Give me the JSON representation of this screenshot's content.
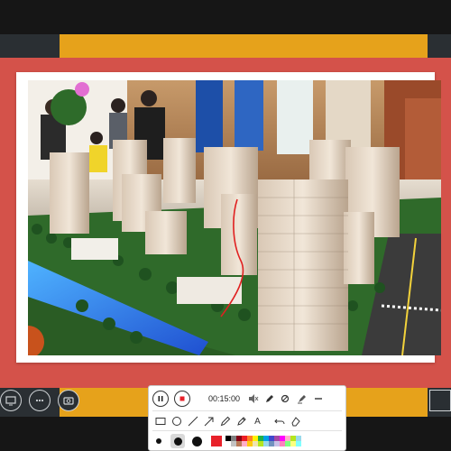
{
  "slide": {
    "colors": {
      "yellow": "#e6a21b",
      "red": "#d4524a",
      "dark": "#2a2f33"
    },
    "photo_subject": "residential-development-scale-model"
  },
  "meeting_controls": [
    {
      "name": "share-screen-icon"
    },
    {
      "name": "more-options-icon"
    },
    {
      "name": "camera-switch-icon"
    }
  ],
  "toolbar": {
    "timer": "00:15:00",
    "row1_icons": [
      "pause-icon",
      "stop-record-icon",
      "mute-icon",
      "pen-icon",
      "eraser-clear-icon",
      "highlighter-icon",
      "minimize-icon"
    ],
    "row2_tools": [
      "rectangle-tool-icon",
      "ellipse-tool-icon",
      "line-tool-icon",
      "arrow-tool-icon",
      "pencil-tool-icon",
      "marker-tool-icon",
      "text-tool-icon",
      "undo-icon",
      "clear-icon"
    ],
    "text_tool_label": "A",
    "stroke_sizes": [
      "small",
      "medium",
      "large"
    ],
    "selected_color": "#e8212a",
    "palette": [
      "#000000",
      "#7f7f7f",
      "#880015",
      "#ed1c24",
      "#ff7f27",
      "#fff200",
      "#22b14c",
      "#00a2e8",
      "#3f48cc",
      "#a349a4",
      "#ff00ff",
      "#ffaec9",
      "#b5e61d",
      "#99d9ea",
      "#ffffff",
      "#c3c3c3",
      "#b97a57",
      "#ffaec9",
      "#ffc90e",
      "#efe4b0",
      "#b5e61d",
      "#99d9ea",
      "#7092be",
      "#c8bfe7",
      "#ff80c0",
      "#80ff80",
      "#ffff80",
      "#80ffff"
    ]
  }
}
